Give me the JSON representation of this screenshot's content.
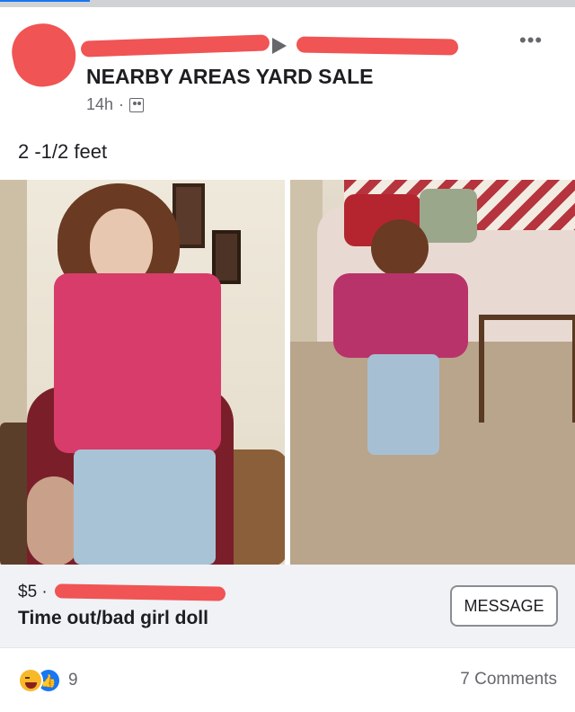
{
  "header": {
    "group_name": "NEARBY AREAS YARD SALE",
    "time": "14h",
    "separator": "·",
    "audience_icon": "group-audience-icon",
    "more_icon": "more-options-icon",
    "more_glyph": "•••"
  },
  "post": {
    "text": "2 -1/2 feet"
  },
  "photos": [
    {
      "subject": "doll-front-photo"
    },
    {
      "subject": "doll-back-photo"
    }
  ],
  "listing": {
    "price": "$5 ·",
    "title": "Time out/bad girl doll",
    "message_label": "MESSAGE"
  },
  "footer": {
    "reaction_icons": [
      "haha-icon",
      "like-icon"
    ],
    "like_glyph": "👍",
    "reaction_count": "9",
    "comments_label": "7 Comments"
  },
  "colors": {
    "redaction": "#f05454",
    "text_primary": "#1c1e21",
    "text_secondary": "#65676b",
    "listing_bg": "#f0f2f5",
    "like_blue": "#1877f2",
    "haha_yellow": "#f7b928"
  }
}
